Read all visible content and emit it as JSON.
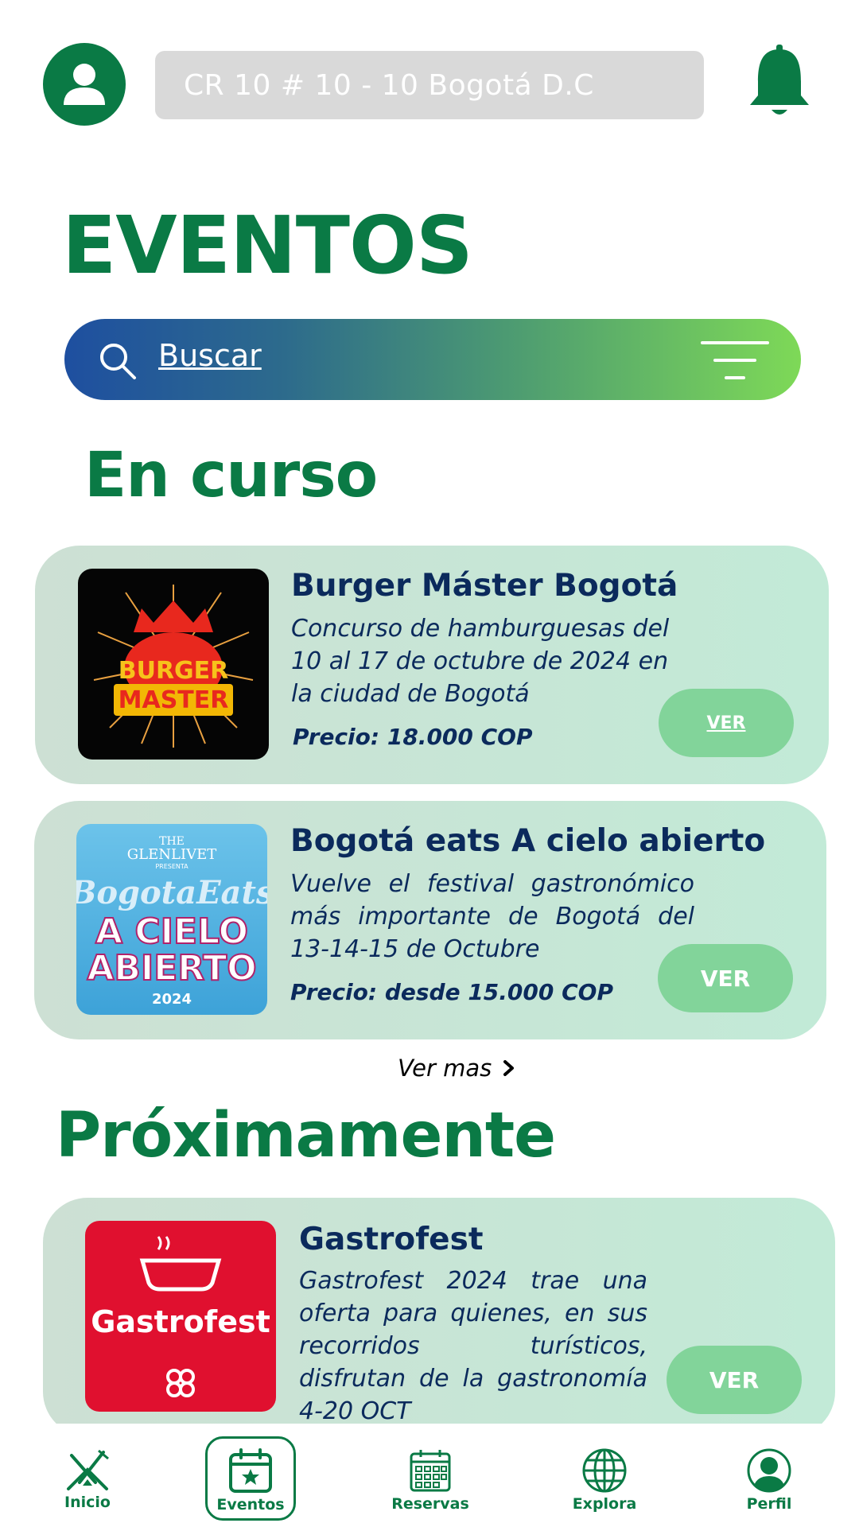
{
  "header": {
    "address": "CR 10 # 10 - 10 Bogotá D.C",
    "avatar_icon": "user-avatar-icon",
    "bell_icon": "bell-icon"
  },
  "page_title": "EVENTOS",
  "search": {
    "placeholder": "Buscar",
    "search_icon": "search-icon",
    "filter_icon": "filter-icon"
  },
  "sections": {
    "current": "En curso",
    "upcoming": "Próximamente"
  },
  "current_events": [
    {
      "title": "Burger Máster Bogotá",
      "description": "Concurso de hamburguesas del 10 al 17 de octubre de 2024 en la ciudad de Bogotá",
      "price": "Precio: 18.000 COP",
      "button": "VER",
      "image_text": [
        "BURGER",
        "MASTER"
      ]
    },
    {
      "title": "Bogotá eats A cielo abierto",
      "description": "Vuelve el festival gastronómico más importante de Bogotá del 13-14-15 de Octubre",
      "price": "Precio: desde 15.000 COP",
      "button": "VER",
      "image_text": [
        "THE",
        "GLENLIVET",
        "PRESENTA",
        "BogotaEats",
        "A CIELO",
        "ABIERTO",
        "2024"
      ]
    }
  ],
  "see_more": "Ver mas",
  "upcoming_events": [
    {
      "title": "Gastrofest",
      "description": "Gastrofest 2024 trae una oferta para quienes, en sus recorridos turísticos, disfrutan de la gastronomía 4-20 OCT",
      "button": "VER",
      "image_text": "Gastrofest"
    }
  ],
  "nav": [
    {
      "label": "Inicio",
      "icon": "home-dining-icon"
    },
    {
      "label": "Eventos",
      "icon": "calendar-star-icon"
    },
    {
      "label": "Reservas",
      "icon": "calendar-grid-icon"
    },
    {
      "label": "Explora",
      "icon": "globe-icon"
    },
    {
      "label": "Perfil",
      "icon": "profile-icon"
    }
  ],
  "colors": {
    "brand_green": "#0a7a45",
    "navy": "#0b2a5c",
    "button_green": "#82d49a",
    "card_bg": "#c2ead7"
  }
}
